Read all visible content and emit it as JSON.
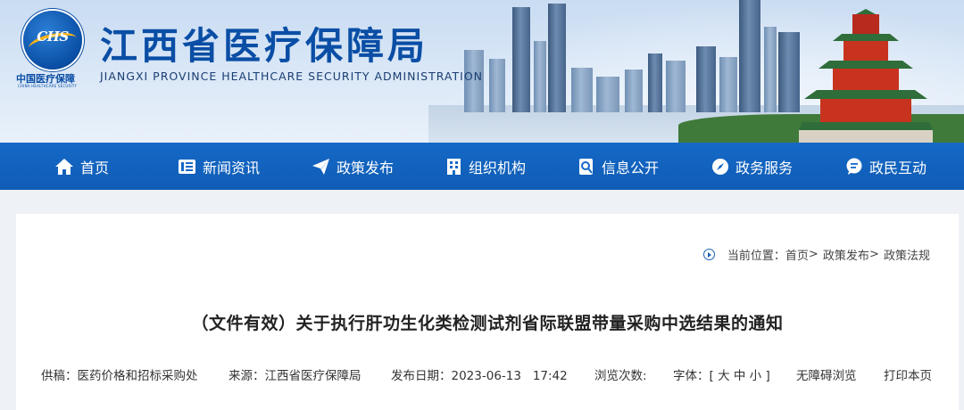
{
  "header": {
    "logo_mark": "CHS",
    "logo_cn": "中国医疗保障",
    "logo_en": "CHINA HEALTHCARE SECURITY",
    "title": "江西省医疗保障局",
    "subtitle": "JIANGXI PROVINCE HEALTHCARE SECURITY ADMINISTRATION"
  },
  "nav": {
    "items": [
      {
        "label": "首页",
        "icon": "home-icon"
      },
      {
        "label": "新闻资讯",
        "icon": "news-icon"
      },
      {
        "label": "政策发布",
        "icon": "send-icon"
      },
      {
        "label": "组织机构",
        "icon": "building-icon"
      },
      {
        "label": "信息公开",
        "icon": "search-doc-icon"
      },
      {
        "label": "政务服务",
        "icon": "compass-icon"
      },
      {
        "label": "政民互动",
        "icon": "chat-icon"
      }
    ]
  },
  "breadcrumb": {
    "prefix": "当前位置：",
    "items": [
      "首页",
      "政策发布",
      "政策法规"
    ],
    "separator": ">"
  },
  "article": {
    "title": "（文件有效）关于执行肝功生化类检测试剂省际联盟带量采购中选结果的通知",
    "meta": {
      "draft_label": "供稿：",
      "draft_value": "医药价格和招标采购处",
      "source_label": "来源：",
      "source_value": "江西省医疗保障局",
      "date_label": "发布日期：",
      "date_value": "2023-06-13   17:42",
      "views_label": "浏览次数:",
      "font_label": "字体：[",
      "font_large": "大",
      "font_medium": "中",
      "font_small": "小",
      "font_close": "]",
      "accessible": "无障碍浏览",
      "print": "打印本页"
    }
  },
  "colors": {
    "brand_blue": "#0a4ea5",
    "nav_blue": "#1569c7",
    "logo_gold": "#f5b31b",
    "page_bg": "#eef1f5"
  }
}
